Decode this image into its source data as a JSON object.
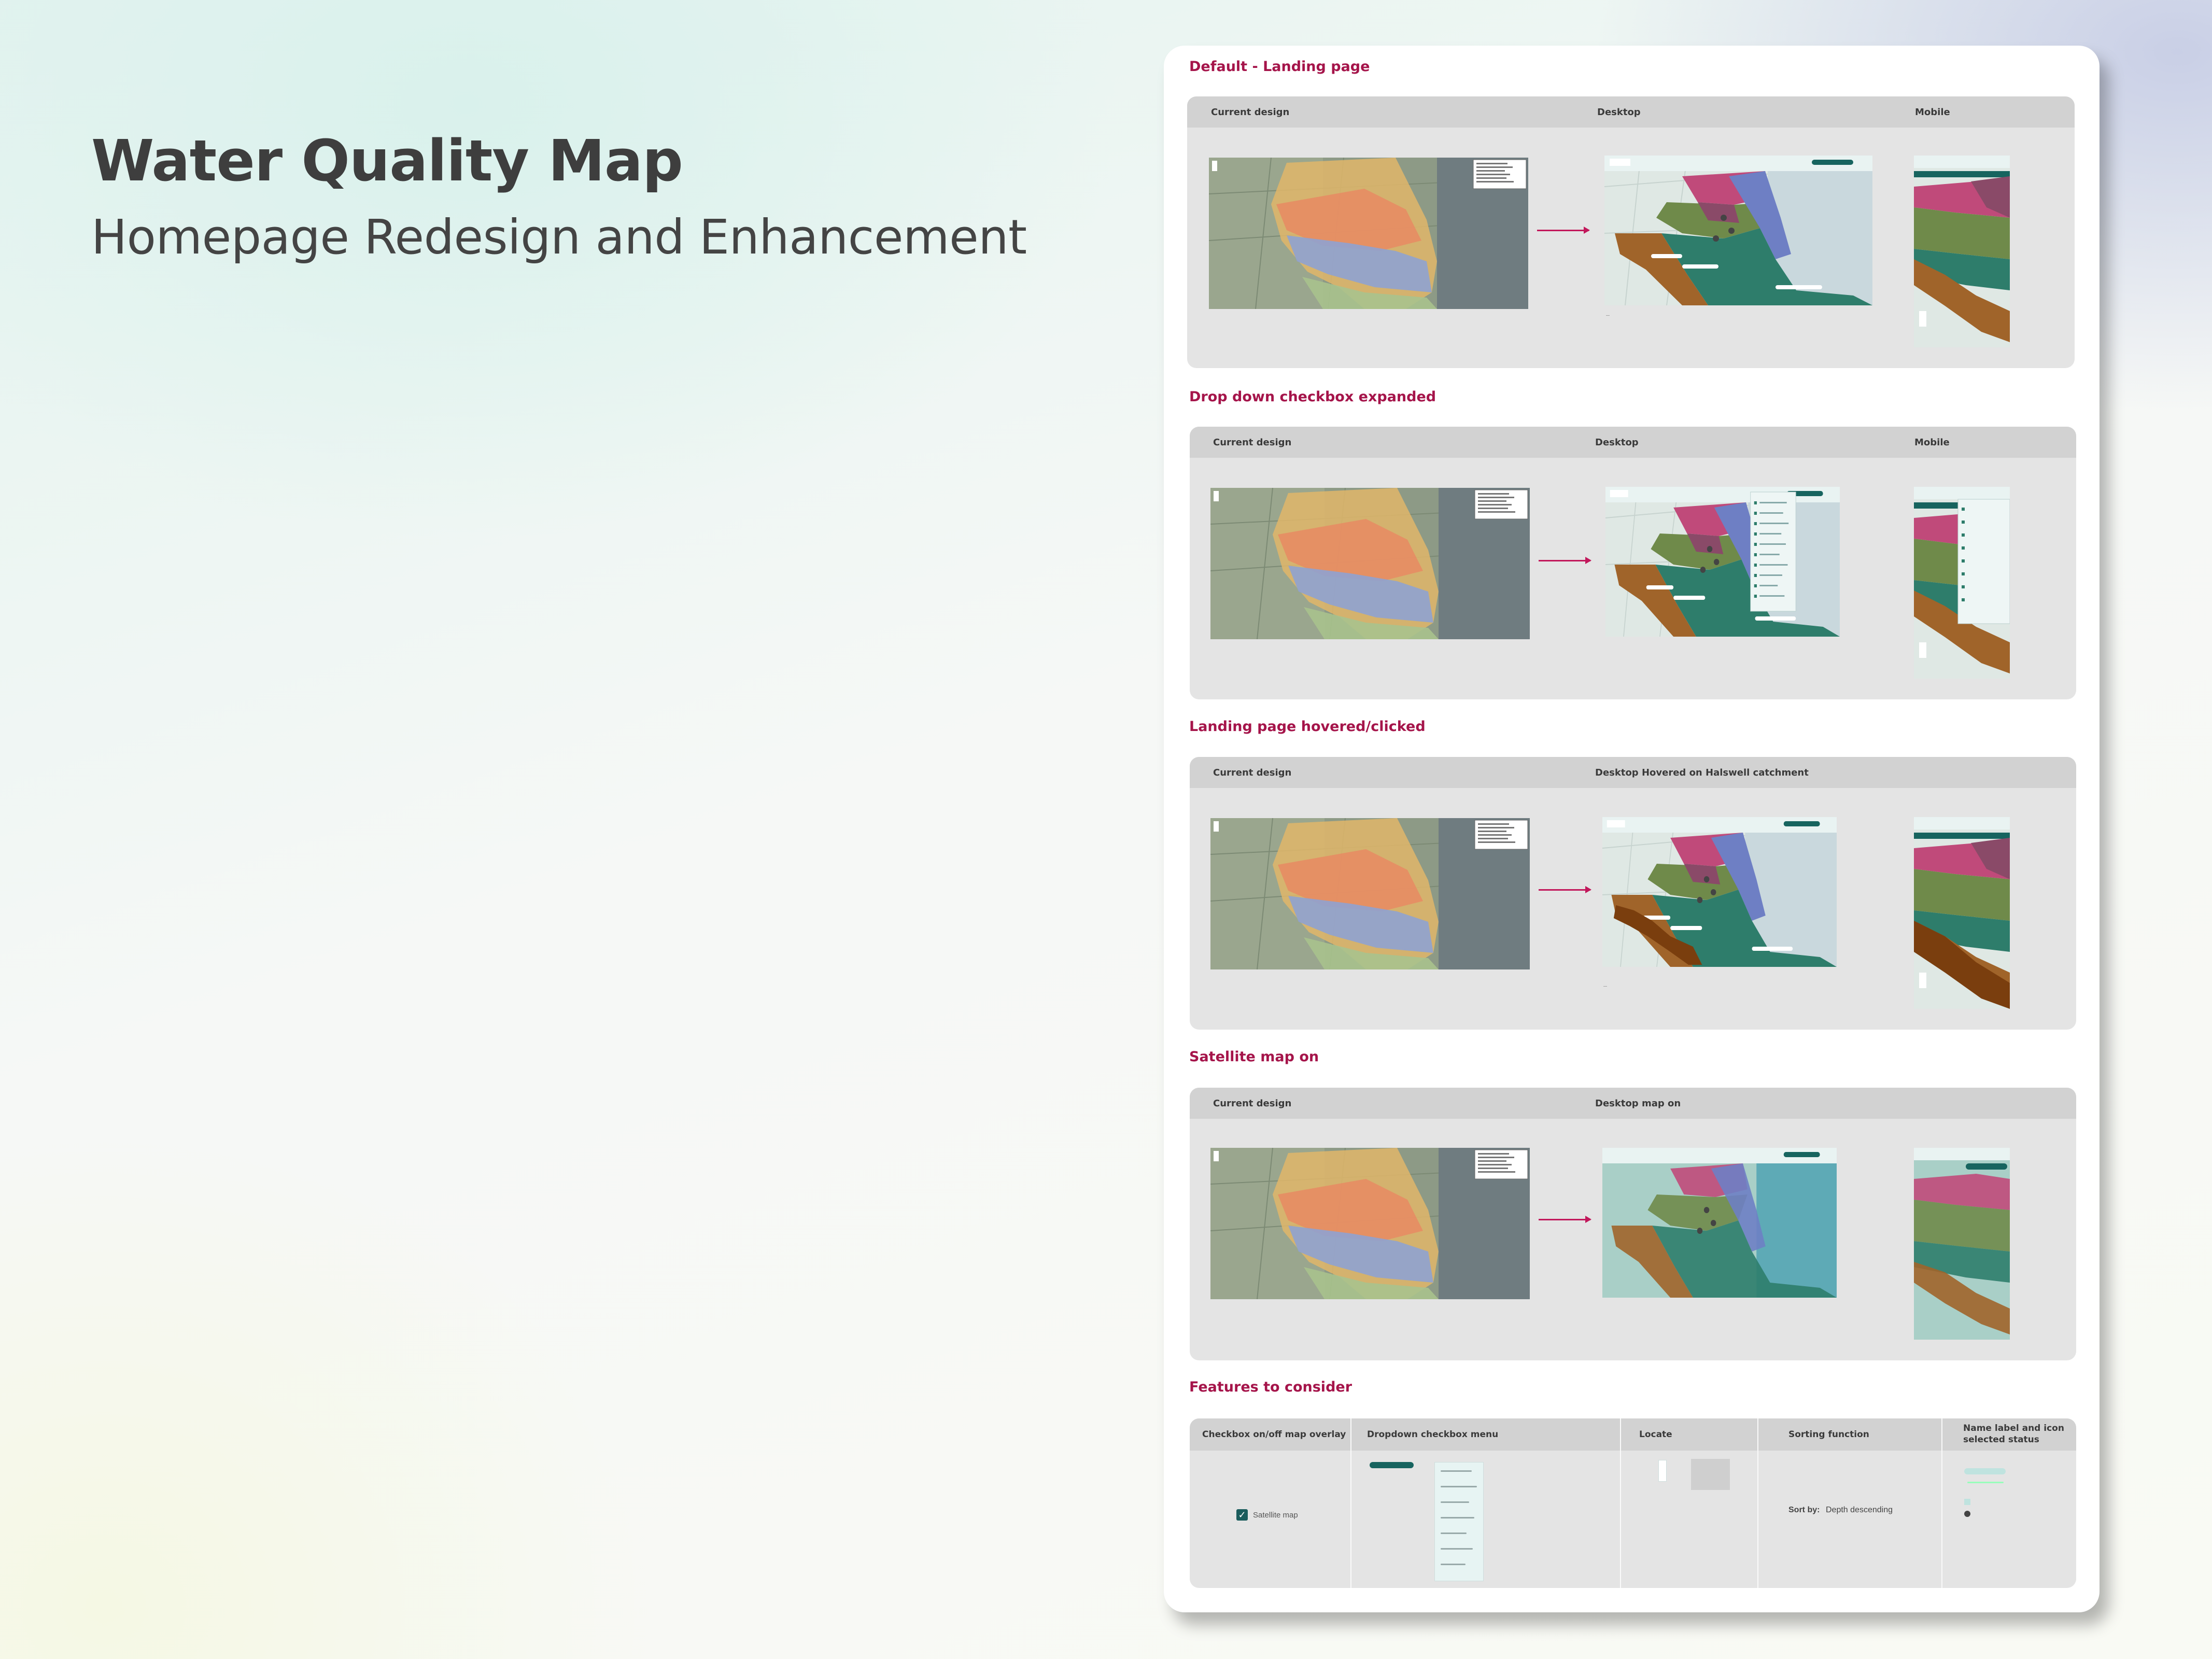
{
  "hero": {
    "title": "Water Quality Map",
    "subtitle": "Homepage Redesign and Enhancement"
  },
  "sections": [
    {
      "title": "Default - Landing page",
      "columns": [
        "Current design",
        "Desktop",
        "Mobile"
      ]
    },
    {
      "title": "Drop down checkbox expanded",
      "columns": [
        "Current design",
        "Desktop",
        "Mobile"
      ]
    },
    {
      "title": "Landing page hovered/clicked",
      "columns": [
        "Current design",
        "Desktop Hovered on Halswell catchment"
      ]
    },
    {
      "title": "Satellite map on",
      "columns": [
        "Current design",
        "Desktop map on"
      ]
    }
  ],
  "features": {
    "title": "Features to consider",
    "columns": [
      "Checkbox on/off map overlay",
      "Dropdown checkbox menu",
      "Locate",
      "Sorting function",
      "Name label and icon selected status"
    ],
    "checkbox_label": "Satellite map",
    "sort": {
      "label": "Sort by:",
      "value": "Depth descending"
    }
  },
  "colors": {
    "accent": "#a5144a",
    "arrow": "#c2185b",
    "teal_dark": "#17645f",
    "pink_catchment": "#c04a7a",
    "olive_catchment": "#6f8a4a",
    "teal_catchment": "#2e7d6b",
    "brown_catchment": "#a0642a",
    "blue_catchment": "#6e7fc4"
  }
}
